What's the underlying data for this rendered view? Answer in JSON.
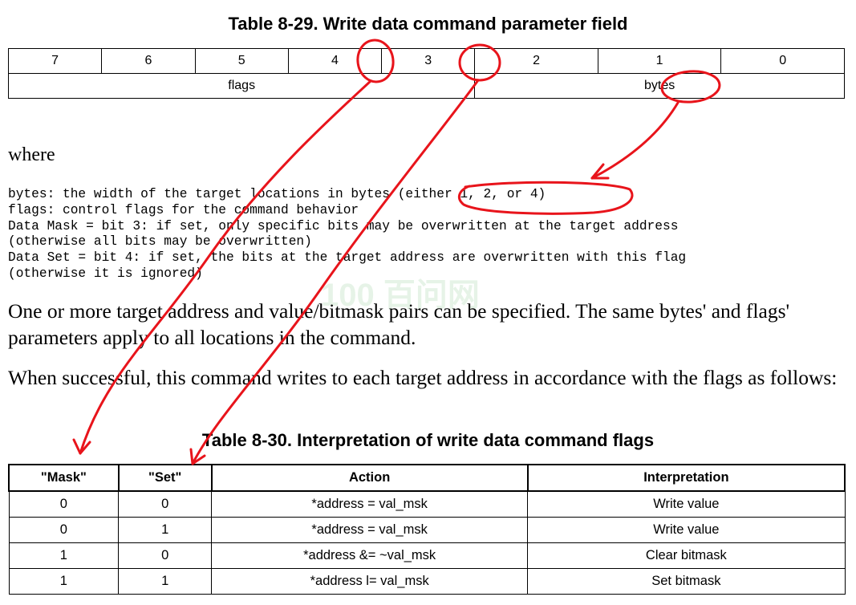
{
  "caption_top": "Table 8-29.  Write data command parameter field",
  "bits_table": {
    "bit_numbers": [
      "7",
      "6",
      "5",
      "4",
      "3",
      "2",
      "1",
      "0"
    ],
    "flags_label": "flags",
    "bytes_label": "bytes"
  },
  "where_label": "where",
  "code_lines": [
    "bytes: the width of the target locations in bytes (either 1, 2, or 4)",
    "flags: control flags for the command behavior",
    "Data Mask = bit 3: if set, only specific bits may be overwritten at the target address",
    "(otherwise all bits may be overwritten)",
    "Data Set = bit 4: if set, the bits at the target address are overwritten with this flag",
    "(otherwise it is ignored)"
  ],
  "paragraph_1": "One or more target address and value/bitmask pairs can be specified. The same bytes' and flags' parameters apply to all locations in the command.",
  "paragraph_2": "When successful, this command writes to each target address in accordance with the flags as follows:",
  "caption_bottom": "Table 8-30.  Interpretation of write data command flags",
  "flags_table": {
    "headers": [
      "\"Mask\"",
      "\"Set\"",
      "Action",
      "Interpretation"
    ],
    "rows": [
      [
        "0",
        "0",
        "*address = val_msk",
        "Write value"
      ],
      [
        "0",
        "1",
        "*address = val_msk",
        "Write value"
      ],
      [
        "1",
        "0",
        "*address &= ~val_msk",
        "Clear bitmask"
      ],
      [
        "1",
        "1",
        "*address l= val_msk",
        "Set bitmask"
      ]
    ]
  },
  "watermark_text": "100 百问网",
  "annotation_color": "#e8141b"
}
